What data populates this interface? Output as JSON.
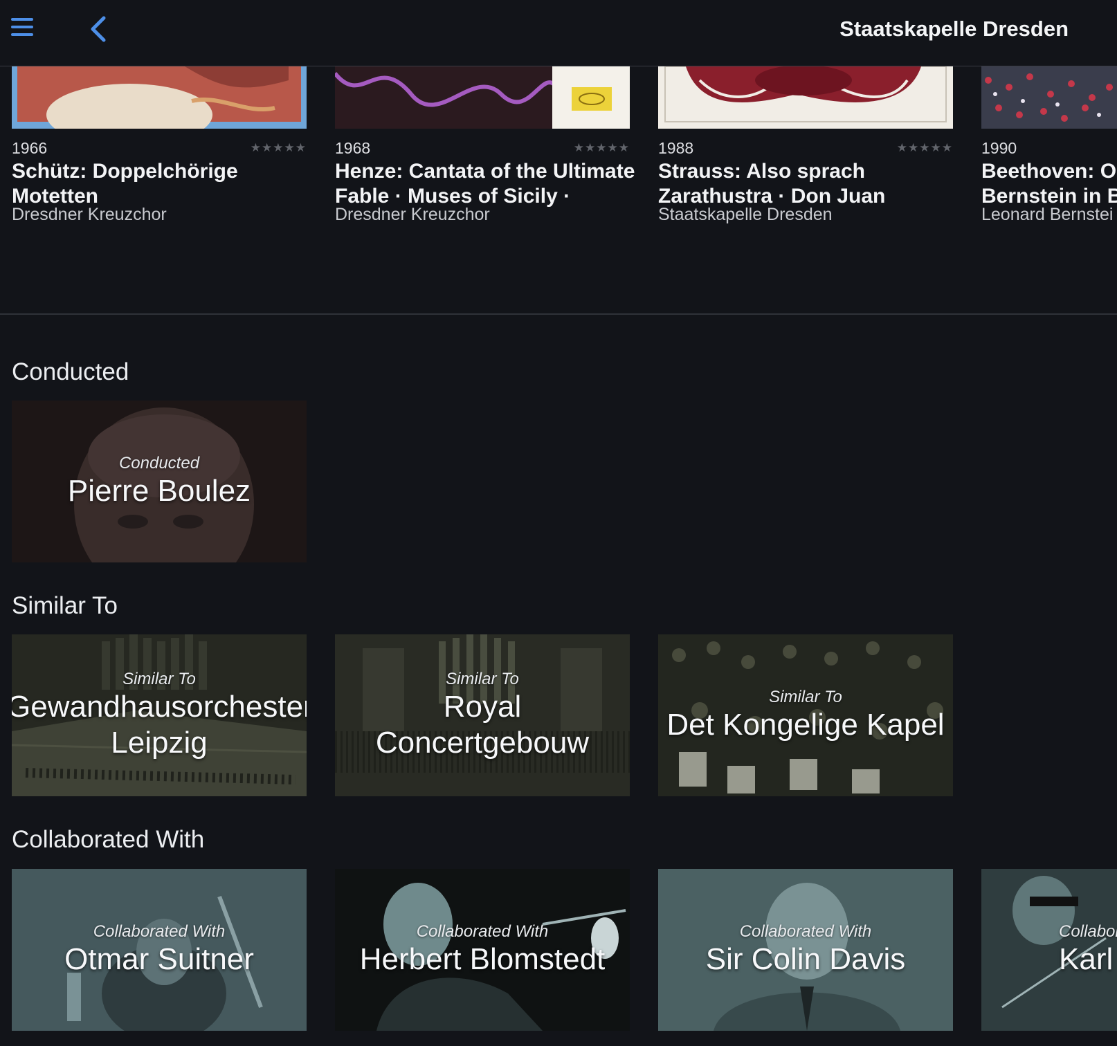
{
  "header": {
    "title": "Staatskapelle Dresden",
    "menu_icon": "hamburger-menu-icon",
    "back_icon": "chevron-left-icon",
    "accent": "#4d8fe8"
  },
  "albums": [
    {
      "year": "1966",
      "stars": "★★★★★",
      "title": "Schütz: Doppelchörige Motetten",
      "artist": "Dresdner Kreuzchor"
    },
    {
      "year": "1968",
      "stars": "★★★★★",
      "title": "Henze: Cantata of the Ultimate Fable · Muses of Sicily ·",
      "artist": "Dresdner Kreuzchor"
    },
    {
      "year": "1988",
      "stars": "★★★★★",
      "title": "Strauss: Also sprach Zarathustra · Don Juan",
      "artist": "Staatskapelle Dresden"
    },
    {
      "year": "1990",
      "stars": "",
      "title": "Beethoven: Od Bernstein in Be",
      "artist": "Leonard Bernstei"
    }
  ],
  "sections": {
    "conducted": {
      "title": "Conducted",
      "cards": [
        {
          "label": "Conducted",
          "name": "Pierre Boulez"
        }
      ]
    },
    "similar": {
      "title": "Similar To",
      "cards": [
        {
          "label": "Similar To",
          "name": "Gewandhausorchester Leipzig"
        },
        {
          "label": "Similar To",
          "name": "Royal Concertgebouw"
        },
        {
          "label": "Similar To",
          "name": "Det Kongelige Kapel"
        }
      ]
    },
    "collaborated": {
      "title": "Collaborated With",
      "cards": [
        {
          "label": "Collaborated With",
          "name": "Otmar Suitner"
        },
        {
          "label": "Collaborated With",
          "name": "Herbert Blomstedt"
        },
        {
          "label": "Collaborated With",
          "name": "Sir Colin Davis"
        },
        {
          "label": "Collaborated With",
          "name": "Karl"
        }
      ]
    }
  }
}
